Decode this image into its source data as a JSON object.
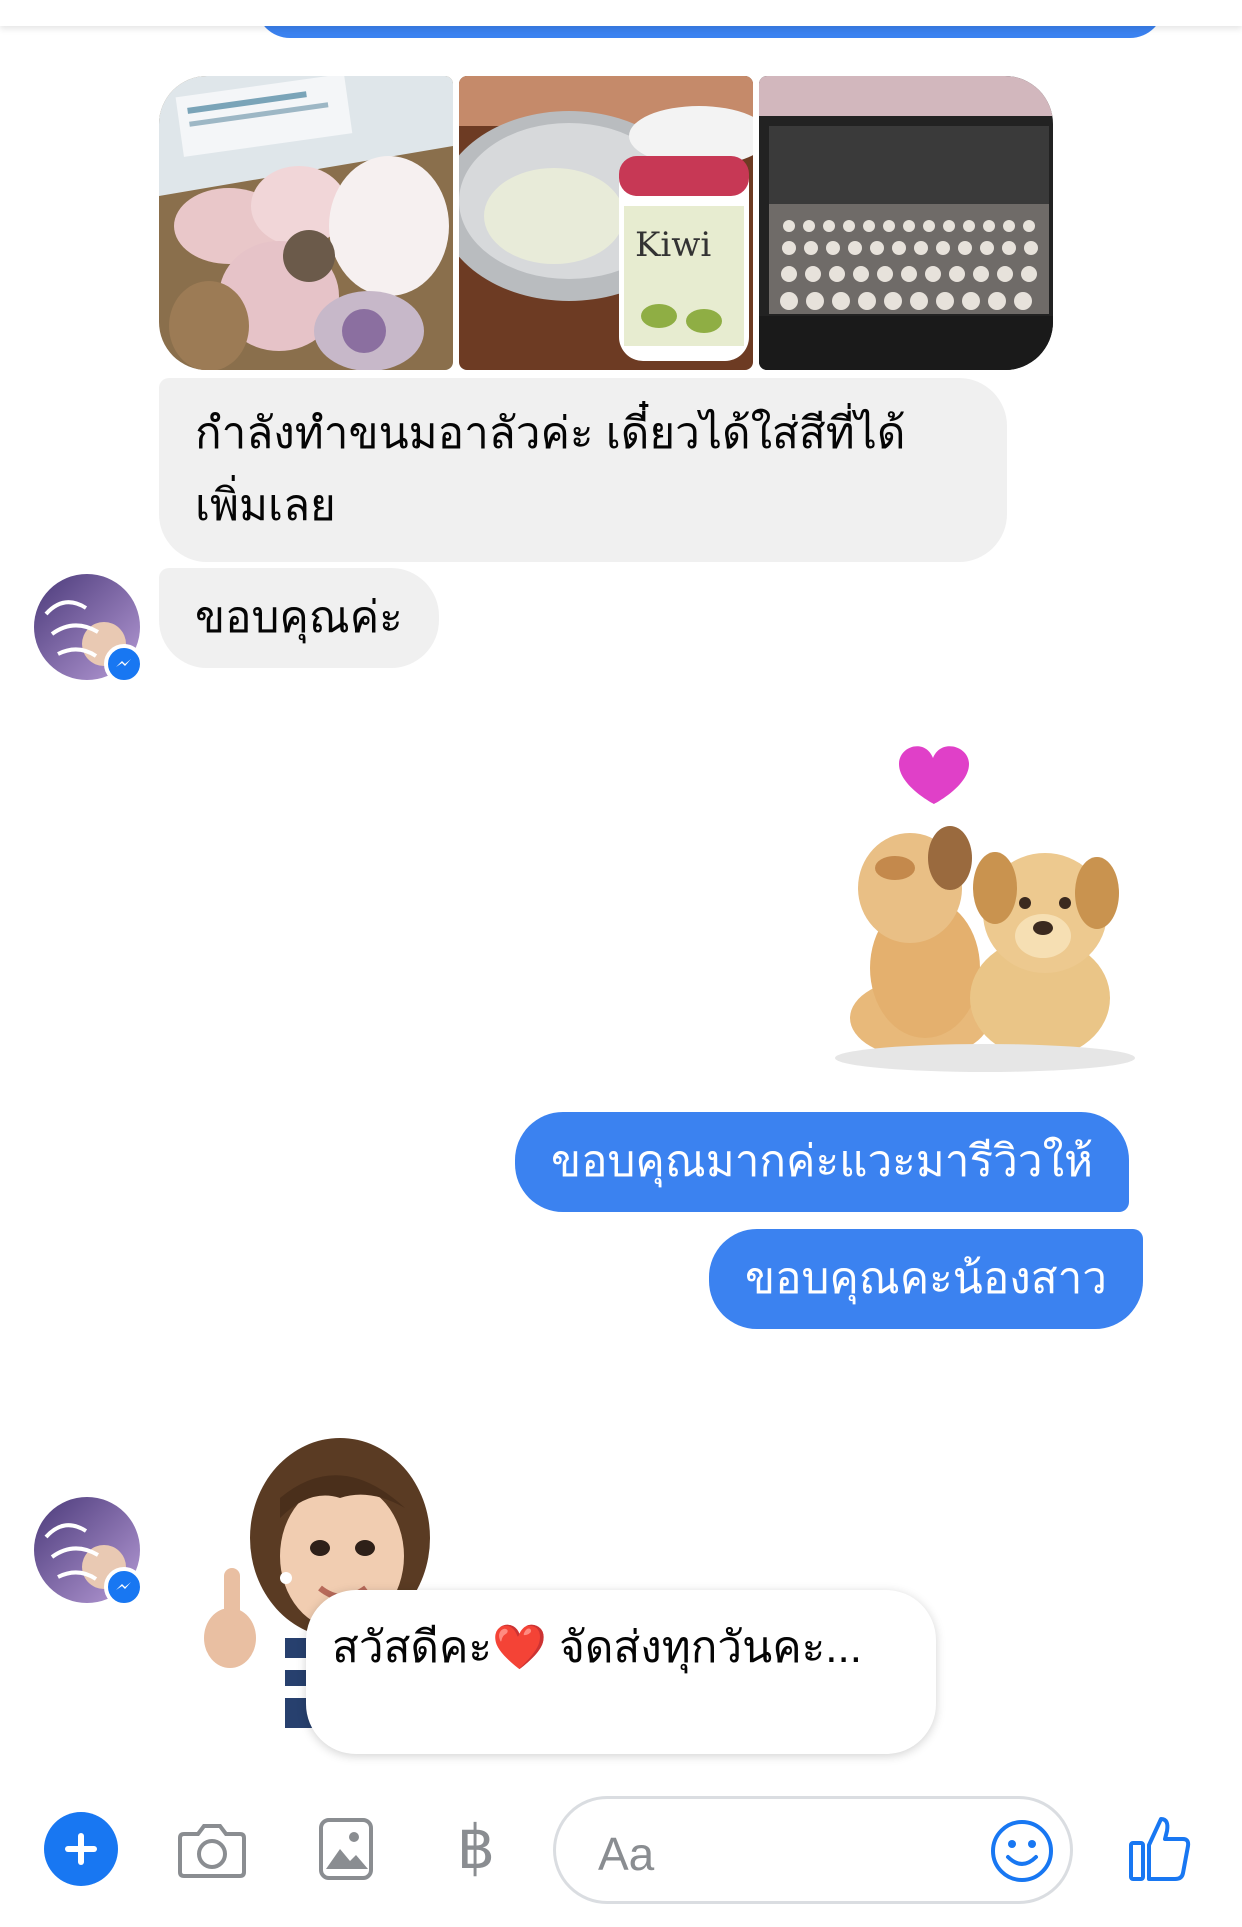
{
  "messages": {
    "incoming_1": "กำลังทำขนมอาลัวค่ะ เดี๋ยวได้ใส่สีที่ได้เพิ่มเลย",
    "incoming_2": "ขอบคุณค่ะ",
    "outgoing_1": "ขอบคุณมากค่ะแวะมารีวิวให้",
    "outgoing_2": "ขอบคุณคะน้องสาว",
    "sticker_caption": "สวัสดีคะ❤️ จัดส่งทุกวันคะ..."
  },
  "photos": [
    {
      "name": "photo-packaged-fruit"
    },
    {
      "name": "photo-mixing-bowl-kiwi"
    },
    {
      "name": "photo-oven-tray"
    }
  ],
  "photo_text": {
    "jar_label": "Kiwi"
  },
  "composer": {
    "placeholder": "Aa",
    "pay_symbol": "฿"
  },
  "colors": {
    "outgoing_bubble": "#3b82f0",
    "incoming_bubble": "#f0f0f0",
    "messenger_blue": "#1877f2",
    "icon_gray": "#8a8d91"
  },
  "icons": [
    "plus-icon",
    "camera-icon",
    "gallery-icon",
    "baht-icon",
    "emoji-icon",
    "thumbs-up-icon",
    "messenger-badge-icon"
  ]
}
